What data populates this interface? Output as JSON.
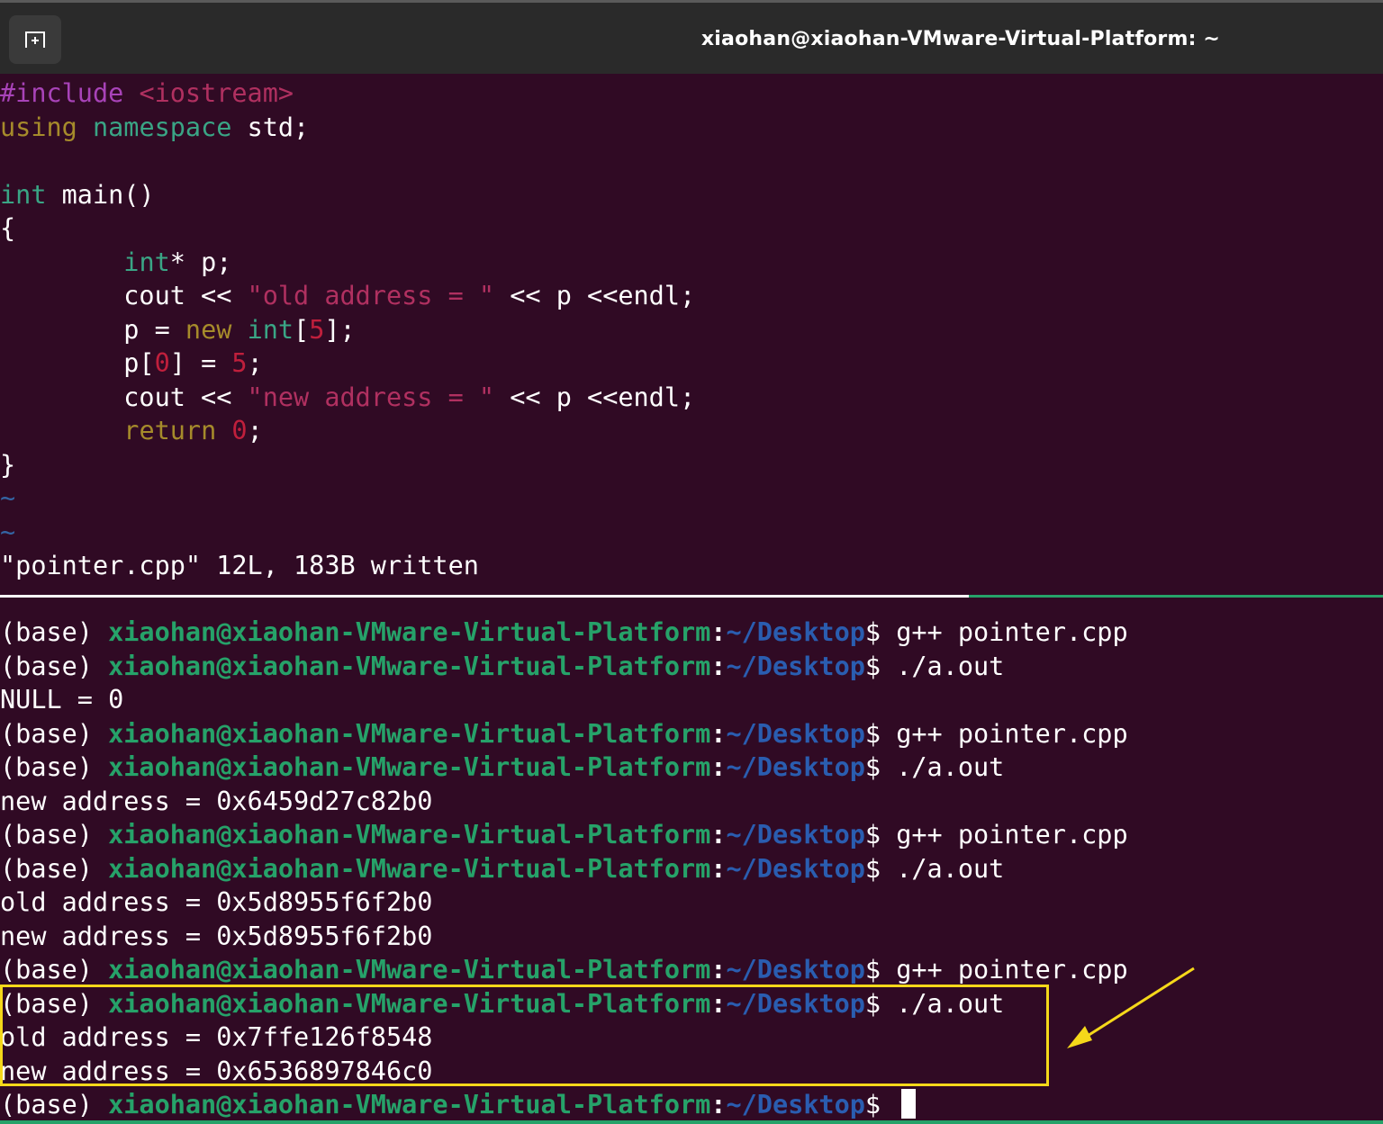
{
  "window": {
    "title": "xiaohan@xiaohan-VMware-Virtual-Platform: ~",
    "new_tab_icon": "new-tab-icon"
  },
  "editor": {
    "lines": [
      [
        {
          "t": "#include ",
          "c": "pre"
        },
        {
          "t": "<iostream>",
          "c": "inc"
        }
      ],
      [
        {
          "t": "using",
          "c": "kw"
        },
        {
          "t": " ",
          "c": ""
        },
        {
          "t": "namespace",
          "c": "type"
        },
        {
          "t": " std;",
          "c": ""
        }
      ],
      [],
      [
        {
          "t": "int",
          "c": "type"
        },
        {
          "t": " main()",
          "c": ""
        }
      ],
      [
        {
          "t": "{",
          "c": ""
        }
      ],
      [
        {
          "t": "        ",
          "c": ""
        },
        {
          "t": "int",
          "c": "type"
        },
        {
          "t": "* p;",
          "c": ""
        }
      ],
      [
        {
          "t": "        cout << ",
          "c": ""
        },
        {
          "t": "\"old address = \"",
          "c": "str"
        },
        {
          "t": " << p <<endl;",
          "c": ""
        }
      ],
      [
        {
          "t": "        p = ",
          "c": ""
        },
        {
          "t": "new",
          "c": "kw"
        },
        {
          "t": " ",
          "c": ""
        },
        {
          "t": "int",
          "c": "type"
        },
        {
          "t": "[",
          "c": ""
        },
        {
          "t": "5",
          "c": "num"
        },
        {
          "t": "];",
          "c": ""
        }
      ],
      [
        {
          "t": "        p[",
          "c": ""
        },
        {
          "t": "0",
          "c": "num"
        },
        {
          "t": "] = ",
          "c": ""
        },
        {
          "t": "5",
          "c": "num"
        },
        {
          "t": ";",
          "c": ""
        }
      ],
      [
        {
          "t": "        cout << ",
          "c": ""
        },
        {
          "t": "\"new address = \"",
          "c": "str"
        },
        {
          "t": " << p <<endl;",
          "c": ""
        }
      ],
      [
        {
          "t": "        ",
          "c": ""
        },
        {
          "t": "return",
          "c": "kw"
        },
        {
          "t": " ",
          "c": ""
        },
        {
          "t": "0",
          "c": "num"
        },
        {
          "t": ";",
          "c": ""
        }
      ],
      [
        {
          "t": "}",
          "c": ""
        }
      ],
      [
        {
          "t": "~",
          "c": "tilde"
        }
      ],
      [
        {
          "t": "~",
          "c": "tilde"
        }
      ]
    ],
    "status": "\"pointer.cpp\" 12L, 183B written"
  },
  "terminal": {
    "prompt_env": "(base) ",
    "prompt_user": "xiaohan@xiaohan-VMware-Virtual-Platform",
    "prompt_sep": ":",
    "prompt_path": "~/Desktop",
    "prompt_end": "$ ",
    "lines": [
      {
        "type": "prompt",
        "cmd": "g++ pointer.cpp"
      },
      {
        "type": "prompt",
        "cmd": "./a.out"
      },
      {
        "type": "output",
        "text": "NULL = 0"
      },
      {
        "type": "prompt",
        "cmd": "g++ pointer.cpp"
      },
      {
        "type": "prompt",
        "cmd": "./a.out"
      },
      {
        "type": "output",
        "text": "new address = 0x6459d27c82b0"
      },
      {
        "type": "prompt",
        "cmd": "g++ pointer.cpp"
      },
      {
        "type": "prompt",
        "cmd": "./a.out"
      },
      {
        "type": "output",
        "text": "old address = 0x5d8955f6f2b0"
      },
      {
        "type": "output",
        "text": "new address = 0x5d8955f6f2b0"
      },
      {
        "type": "prompt",
        "cmd": "g++ pointer.cpp"
      },
      {
        "type": "prompt",
        "cmd": "./a.out"
      },
      {
        "type": "output",
        "text": "old address = 0x7ffe126f8548"
      },
      {
        "type": "output",
        "text": "new address = 0x6536897846c0"
      },
      {
        "type": "prompt",
        "cmd": "",
        "cursor": true
      }
    ]
  },
  "annotation": {
    "box_color": "#f5d81a",
    "arrow_color": "#f5d81a"
  },
  "colors": {
    "background": "#300a24",
    "titlebar": "#2a2a2a",
    "prompt_user": "#26a269",
    "prompt_path": "#2a5db0"
  }
}
